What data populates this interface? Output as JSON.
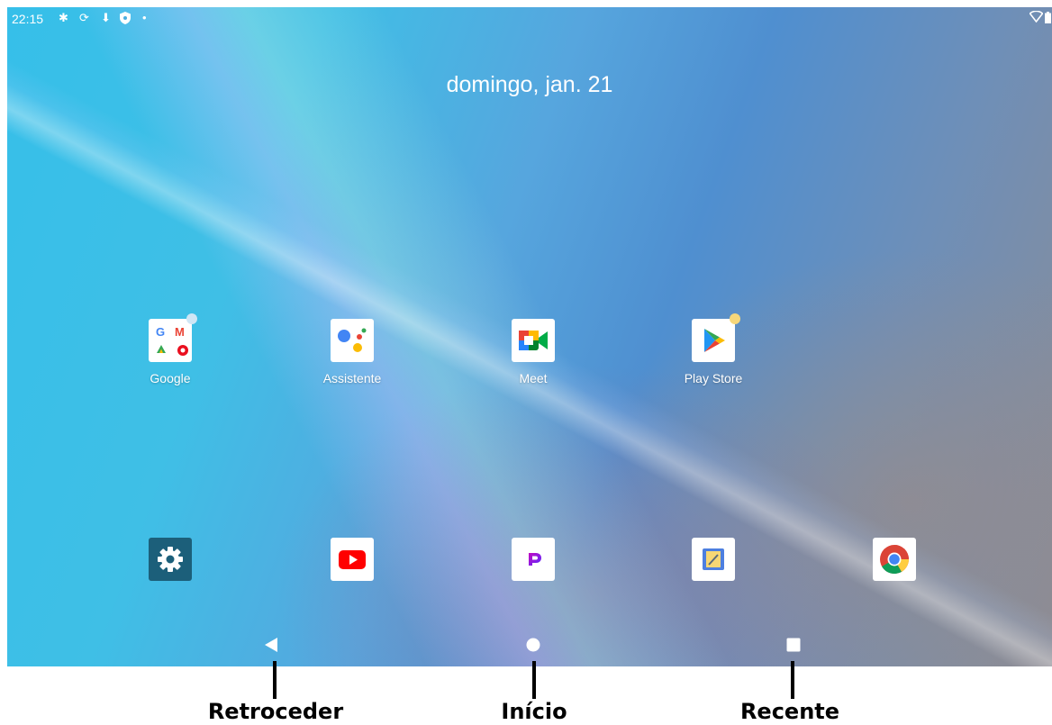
{
  "status_bar": {
    "time": "22:15",
    "left_icons": [
      "gear-icon",
      "sync-icon",
      "download-icon",
      "shield-icon",
      "dot-icon"
    ],
    "right_icons": [
      "wifi-icon",
      "battery-icon"
    ]
  },
  "home": {
    "date": "domingo, jan. 21",
    "apps": [
      {
        "name": "google-folder",
        "label": "Google"
      },
      {
        "name": "assistant",
        "label": "Assistente"
      },
      {
        "name": "meet",
        "label": "Meet"
      },
      {
        "name": "play-store",
        "label": "Play Store"
      }
    ],
    "dock": [
      "settings",
      "youtube",
      "picsart",
      "notes",
      "chrome"
    ]
  },
  "nav_bar": {
    "buttons": [
      "back",
      "home",
      "recents"
    ]
  },
  "annotations": {
    "back": "Retroceder",
    "home": "Início",
    "recents": "Recente"
  },
  "colors": {
    "wallpaper_cyan": "#36bfe9",
    "wallpaper_blue": "#4f8fd0",
    "wallpaper_gray": "#8c8c95",
    "notification_dot_blue": "#cfe6f5",
    "notification_dot_yellow": "#f6d77a",
    "settings_tile": "#1c5f7a"
  }
}
